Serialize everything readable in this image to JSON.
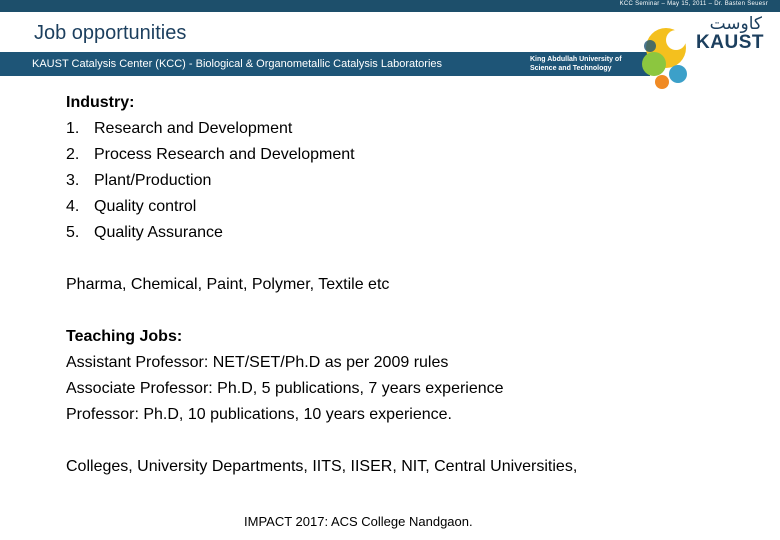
{
  "header": {
    "meta": "KCC Seminar – May 15, 2011 – Dr. Basten Seuesr",
    "title": "Job opportunities",
    "banner": "KAUST Catalysis Center (KCC) - Biological & Organometallic Catalysis Laboratories",
    "university_line1": "King Abdullah University of",
    "university_line2": "Science and Technology",
    "logo_arabic": "كاوست",
    "logo_text": "KAUST"
  },
  "industry": {
    "heading": "Industry:",
    "items": [
      {
        "num": "1.",
        "text": "Research and Development"
      },
      {
        "num": "2.",
        "text": "Process Research and Development"
      },
      {
        "num": "3.",
        "text": "Plant/Production"
      },
      {
        "num": "4.",
        "text": "Quality control"
      },
      {
        "num": "5.",
        "text": "Quality Assurance"
      }
    ]
  },
  "sectors": "Pharma, Chemical, Paint, Polymer, Textile etc",
  "teaching": {
    "heading": "Teaching Jobs:",
    "lines": [
      "Assistant Professor: NET/SET/Ph.D as per 2009 rules",
      "Associate Professor: Ph.D, 5 publications, 7 years experience",
      "Professor: Ph.D, 10 publications, 10 years experience."
    ]
  },
  "institutions": "Colleges, University Departments, IITS, IISER, NIT, Central Universities,",
  "footer": "IMPACT 2017: ACS College Nandgaon.",
  "colors": {
    "banner": "#1e5577",
    "title": "#1c3f5e"
  }
}
